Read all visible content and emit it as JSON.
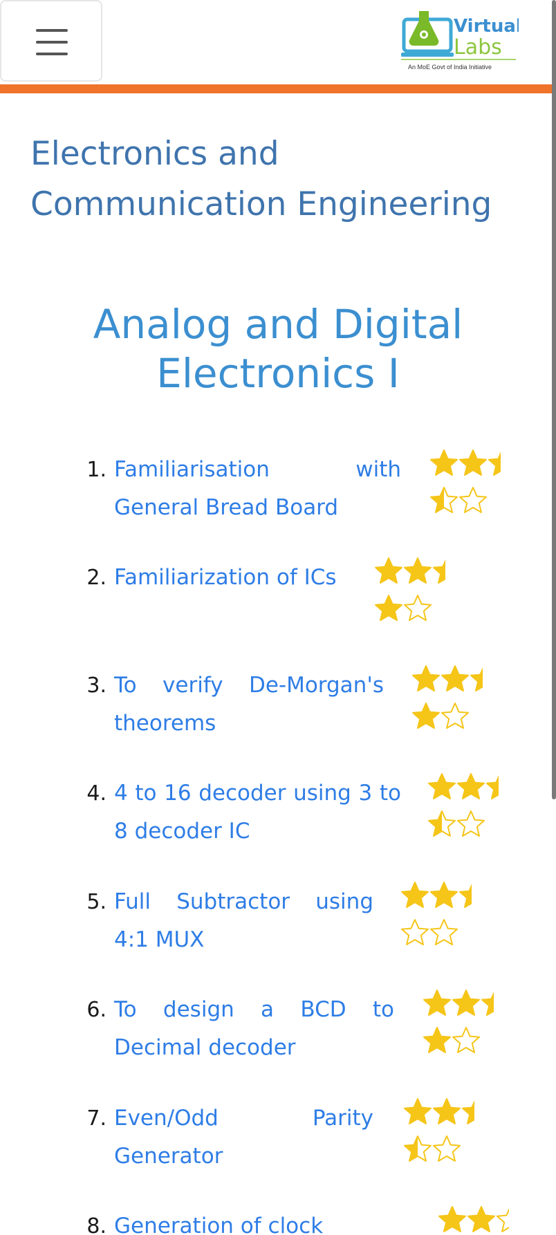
{
  "header": {
    "logo_line1": "Virtual",
    "logo_line2": "Labs",
    "logo_tagline": "An MoE Govt of India Initiative"
  },
  "department": {
    "title": "Electronics and Communication Engineering"
  },
  "lab": {
    "title": "Analog and Digital Electronics I"
  },
  "experiments": [
    {
      "number": "1.",
      "title": "Familiarisation with General Bread Board",
      "rating": 3.5
    },
    {
      "number": "2.",
      "title": "Familiarization of ICs",
      "rating": 4
    },
    {
      "number": "3.",
      "title": "To verify De-Morgan's theorems",
      "rating": 4
    },
    {
      "number": "4.",
      "title": "4 to 16 decoder using 3 to 8 decoder IC",
      "rating": 3.5
    },
    {
      "number": "5.",
      "title": "Full Subtractor using 4:1 MUX",
      "rating": 3
    },
    {
      "number": "6.",
      "title": "To design a BCD to Decimal decoder",
      "rating": 4
    },
    {
      "number": "7.",
      "title": "Even/Odd Parity Generator",
      "rating": 3.5
    },
    {
      "number": "8.",
      "title": "Generation of clock",
      "rating": 2
    }
  ],
  "colors": {
    "accent_orange": "#f0732b",
    "dept_title": "#3f74ad",
    "lab_title": "#3b8fd0",
    "link": "#2e7de6",
    "star": "#f5c518"
  },
  "icons": {
    "menu": "hamburger-icon",
    "star_full": "star-filled-icon",
    "star_half": "star-half-icon",
    "star_empty": "star-empty-icon"
  }
}
